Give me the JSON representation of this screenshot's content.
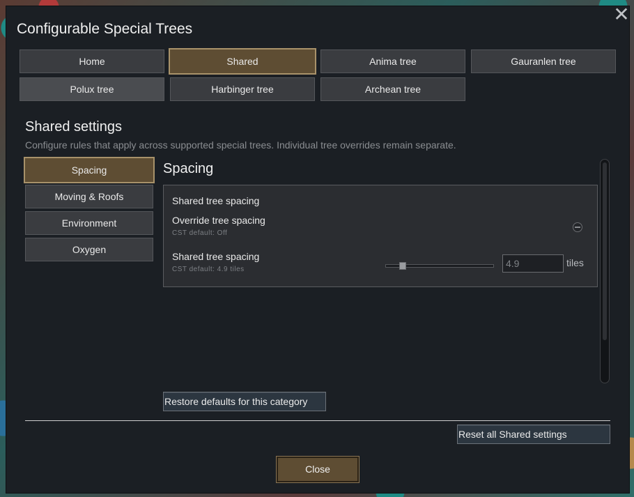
{
  "window": {
    "title": "Configurable Special Trees",
    "close_glyph": "✕"
  },
  "tabs": [
    {
      "label": "Home",
      "state": "normal"
    },
    {
      "label": "Shared",
      "state": "active"
    },
    {
      "label": "Anima tree",
      "state": "normal"
    },
    {
      "label": "Gauranlen tree",
      "state": "normal"
    },
    {
      "label": "Polux tree",
      "state": "hover"
    },
    {
      "label": "Harbinger tree",
      "state": "normal"
    },
    {
      "label": "Archean tree",
      "state": "normal"
    }
  ],
  "section": {
    "title": "Shared settings",
    "description": "Configure rules that apply across supported special trees. Individual tree overrides remain separate."
  },
  "categories": [
    {
      "label": "Spacing",
      "active": true
    },
    {
      "label": "Moving & Roofs",
      "active": false
    },
    {
      "label": "Environment",
      "active": false
    },
    {
      "label": "Oxygen",
      "active": false
    }
  ],
  "panel": {
    "title": "Spacing",
    "group_heading": "Shared tree spacing",
    "override": {
      "label": "Override tree spacing",
      "default_note": "CST default: Off",
      "enabled": false
    },
    "spacing": {
      "label": "Shared tree spacing",
      "default_note": "CST default: 4.9 tiles",
      "value": "4.9",
      "unit": "tiles",
      "slider_fraction": 0.13
    }
  },
  "buttons": {
    "restore_category": "Restore defaults for this category",
    "reset_all": "Reset all Shared settings",
    "close": "Close"
  },
  "colors": {
    "window_bg": "#1b1f24",
    "active_tab": "#5e4d33",
    "active_border": "#a8926a"
  }
}
